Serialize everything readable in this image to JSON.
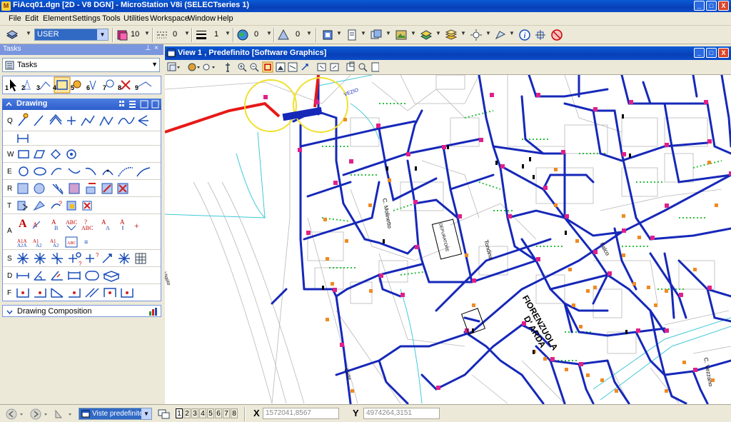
{
  "window": {
    "title": "FiAcq01.dgn [2D - V8 DGN] - MicroStation V8i (SELECTseries 1)",
    "controls": [
      "_",
      "□",
      "X"
    ]
  },
  "menu": [
    "File",
    "Edit",
    "Element",
    "Settings",
    "Tools",
    "Utilities",
    "Workspace",
    "Window",
    "Help"
  ],
  "toolbar": {
    "level": "USER",
    "color": "10",
    "style": "0",
    "weight": "1",
    "transparency": "0",
    "priority": "0"
  },
  "tasks_panel": {
    "title": "Tasks",
    "combo_value": "Tasks",
    "task_numbers": [
      "1",
      "2",
      "3",
      "4",
      "5",
      "6",
      "7",
      "8",
      "9"
    ],
    "drawing_header": "Drawing",
    "row_keys": [
      "Q",
      "W",
      "E",
      "R",
      "T",
      "A",
      "S",
      "D",
      "F"
    ],
    "drawing_composition": "Drawing Composition"
  },
  "view": {
    "title": "View 1 , Predefinito [Software Graphics]"
  },
  "map_labels": {
    "fiorenzuola": "FIORENZUOLA",
    "arda": "D' ARDA",
    "molinetto": "C. Molinetto",
    "vezzano": "C. Vezzano",
    "tondina": "Tondina",
    "falco": "Falco",
    "vigolo": "Vigolo",
    "vezio": "VEZIO",
    "corte": "Corte",
    "impianto": "DEPURATORE"
  },
  "statusbar": {
    "view_set": "Viste predefinite",
    "view_numbers": [
      "1",
      "2",
      "3",
      "4",
      "5",
      "6",
      "7",
      "8"
    ],
    "x_label": "X",
    "x_value": "1572041,8567",
    "y_label": "Y",
    "y_value": "4974264,3151"
  }
}
